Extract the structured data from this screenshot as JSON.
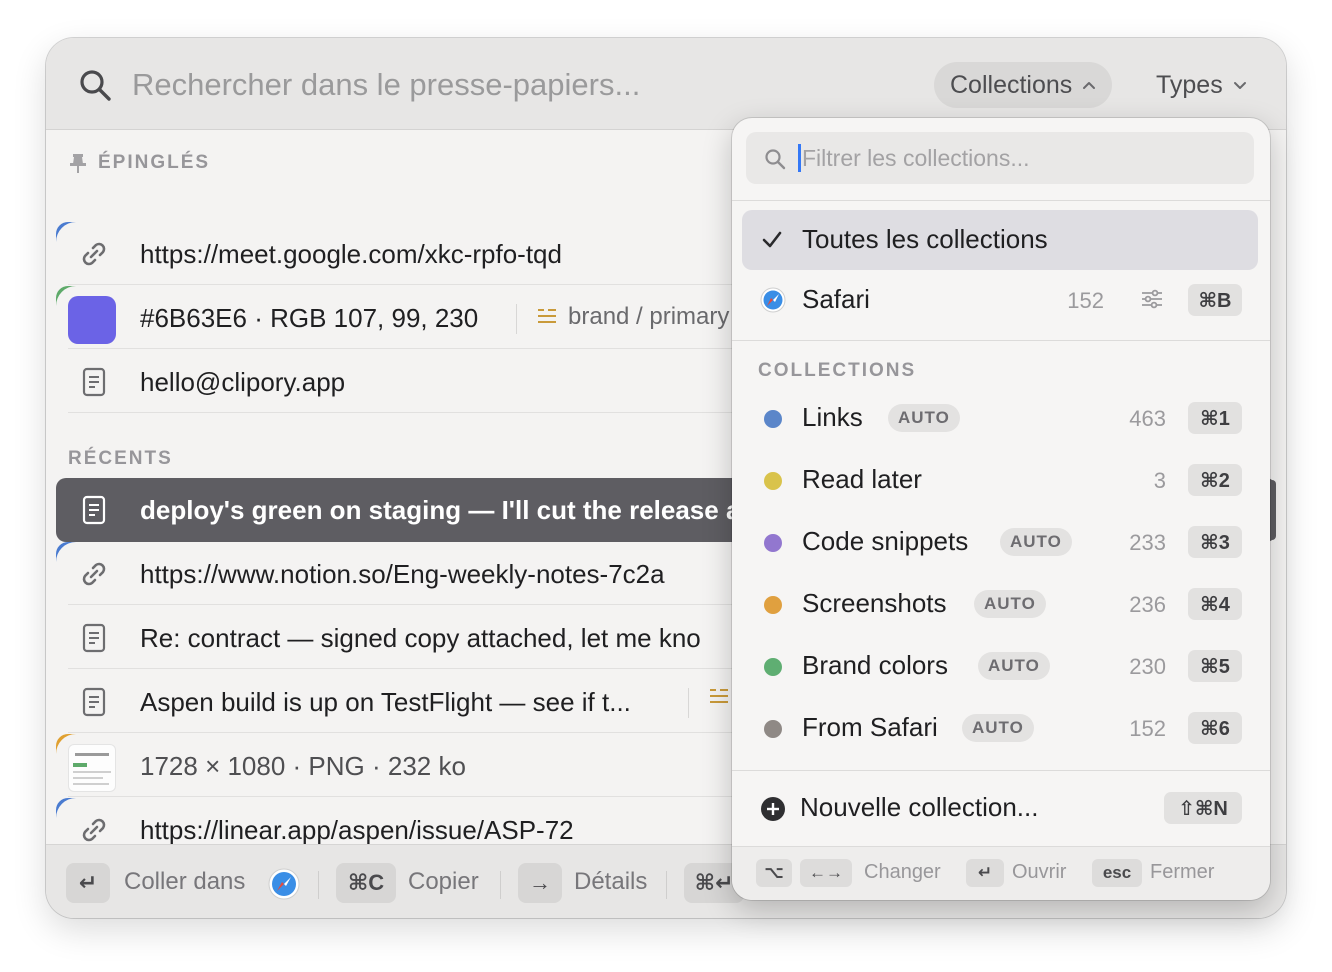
{
  "search": {
    "placeholder": "Rechercher dans le presse-papiers..."
  },
  "header": {
    "collections_label": "Collections",
    "types_label": "Types"
  },
  "sections": {
    "pinned": "ÉPINGLÉS",
    "recent": "RÉCENTS"
  },
  "pinned": [
    {
      "type": "link",
      "text": "https://meet.google.com/xkc-rpfo-tqd",
      "corner_color": "#4a7bd0"
    },
    {
      "type": "color",
      "text": "#6B63E6 · RGB 107, 99, 230",
      "swatch": "#6b63e6",
      "tag": "brand / primary",
      "corner_color": "#5eaa6a"
    },
    {
      "type": "text",
      "text": "hello@clipory.app"
    }
  ],
  "recent": [
    {
      "type": "text",
      "text": "deploy's green on staging — I'll cut the release a",
      "selected": true
    },
    {
      "type": "link",
      "text": "https://www.notion.so/Eng-weekly-notes-7c2a",
      "corner_color": "#4a7bd0"
    },
    {
      "type": "text",
      "text": "Re: contract — signed copy attached, let me kno"
    },
    {
      "type": "text",
      "text": "Aspen build is up on TestFlight — see if t..."
    },
    {
      "type": "image",
      "text": "1728 × 1080 · PNG · 232 ko",
      "corner_color": "#e0a030"
    },
    {
      "type": "link",
      "text": "https://linear.app/aspen/issue/ASP-72",
      "corner_color": "#4a7bd0"
    }
  ],
  "footer": {
    "paste_key": "↵",
    "paste_label": "Coller dans",
    "copy_key": "⌘C",
    "copy_label": "Copier",
    "details_key": "→",
    "details_label": "Détails",
    "more_key": "⌘↵"
  },
  "dropdown": {
    "filter_placeholder": "Filtrer les collections...",
    "all_label": "Toutes les collections",
    "source": {
      "name": "Safari",
      "count": "152",
      "key": "⌘B"
    },
    "section_label": "COLLECTIONS",
    "auto_label": "AUTO",
    "collections": [
      {
        "name": "Links",
        "auto": true,
        "count": "463",
        "key": "⌘1",
        "color": "#5b86c9"
      },
      {
        "name": "Read later",
        "auto": false,
        "count": "3",
        "key": "⌘2",
        "color": "#d9c34b"
      },
      {
        "name": "Code snippets",
        "auto": true,
        "count": "233",
        "key": "⌘3",
        "color": "#9277cf"
      },
      {
        "name": "Screenshots",
        "auto": true,
        "count": "236",
        "key": "⌘4",
        "color": "#e0a03f"
      },
      {
        "name": "Brand colors",
        "auto": true,
        "count": "230",
        "key": "⌘5",
        "color": "#5fae72"
      },
      {
        "name": "From Safari",
        "auto": true,
        "count": "152",
        "key": "⌘6",
        "color": "#8f8985"
      }
    ],
    "new_label": "Nouvelle collection...",
    "new_key": "⇧⌘N",
    "footer": {
      "switch_key1": "⌥",
      "switch_key2": "←→",
      "switch_label": "Changer",
      "open_key": "↵",
      "open_label": "Ouvrir",
      "close_key": "esc",
      "close_label": "Fermer"
    }
  }
}
